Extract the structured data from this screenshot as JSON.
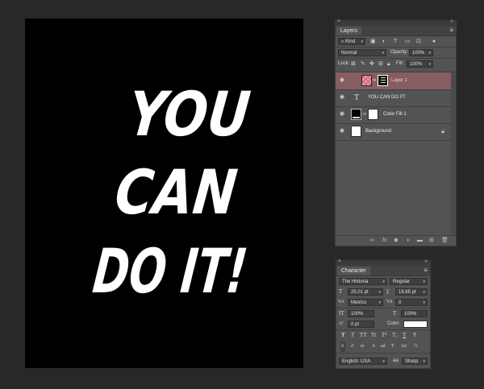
{
  "canvas": {
    "lines": [
      "YOU",
      "CAN",
      "DO IT!"
    ],
    "bg": "#000000",
    "text_color": "#ffffff"
  },
  "layers_panel": {
    "tab": "Layers",
    "filter_kind": "Kind",
    "blend_mode": "Normal",
    "opacity_label": "Opacity:",
    "opacity_value": "100%",
    "lock_label": "Lock:",
    "fill_label": "Fill:",
    "fill_value": "100%",
    "layers": [
      {
        "name": "Layer 1",
        "kind": "raster",
        "selected": true,
        "locked": false
      },
      {
        "name": "YOU CAN  DO IT!",
        "kind": "text",
        "selected": false,
        "locked": false
      },
      {
        "name": "Color Fill 1",
        "kind": "fill",
        "selected": false,
        "locked": false
      },
      {
        "name": "Background",
        "kind": "background",
        "selected": false,
        "locked": true
      }
    ],
    "selected_color": "#875d64"
  },
  "character_panel": {
    "tab": "Character",
    "font_family": "The Historia",
    "font_style": "Regular",
    "font_size": "25,01 pt",
    "leading": "19,65 pt",
    "kerning": "Metrics",
    "tracking": "0",
    "vertical_scale": "100%",
    "horizontal_scale": "100%",
    "baseline_shift": "0 pt",
    "color_label": "Color:",
    "language": "English: USA",
    "antialias": "Sharp",
    "type_styles": [
      "T",
      "T",
      "TT",
      "Tt",
      "T¹",
      "T₁",
      "T",
      "Ŧ"
    ],
    "opentype": [
      "fi",
      "ơ",
      "st",
      "A",
      "ad",
      "T",
      "1st",
      "½"
    ]
  }
}
